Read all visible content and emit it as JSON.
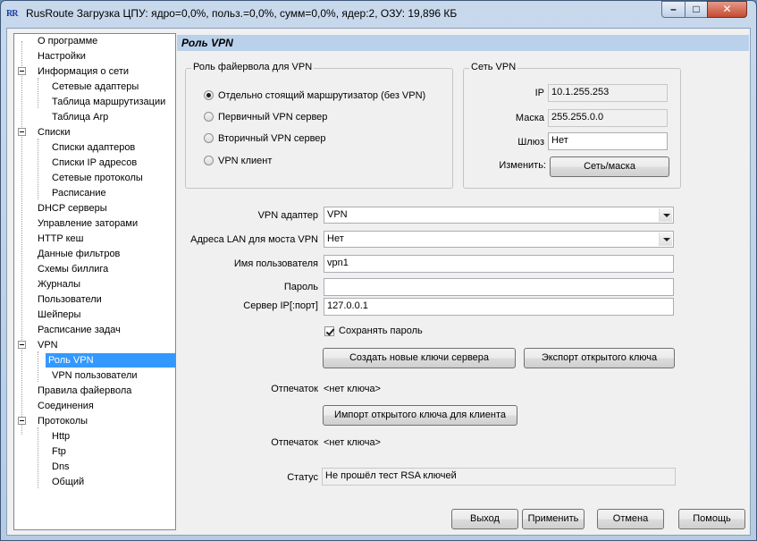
{
  "window": {
    "app_icon": "RR",
    "title": "RusRoute   Загрузка ЦПУ: ядро=0,0%, польз.=0,0%, сумм=0,0%, ядер:2,  ОЗУ: 19,896 КБ",
    "minimize_icon": "minimize-icon",
    "maximize_icon": "maximize-icon",
    "close_icon": "close-icon",
    "close_glyph": "✕"
  },
  "tree": {
    "items": [
      {
        "label": "О программе"
      },
      {
        "label": "Настройки"
      },
      {
        "label": "Информация о сети"
      },
      {
        "label": "Сетевые адаптеры"
      },
      {
        "label": "Таблица маршрутизации"
      },
      {
        "label": "Таблица Arp"
      },
      {
        "label": "Списки"
      },
      {
        "label": "Списки адаптеров"
      },
      {
        "label": "Списки IP адресов"
      },
      {
        "label": "Сетевые протоколы"
      },
      {
        "label": "Расписание"
      },
      {
        "label": "DHCP серверы"
      },
      {
        "label": "Управление заторами"
      },
      {
        "label": "HTTP кеш"
      },
      {
        "label": "Данные фильтров"
      },
      {
        "label": "Схемы биллига"
      },
      {
        "label": "Журналы"
      },
      {
        "label": "Пользователи"
      },
      {
        "label": "Шейперы"
      },
      {
        "label": "Расписание задач"
      },
      {
        "label": "VPN"
      },
      {
        "label": "Роль VPN"
      },
      {
        "label": "VPN пользователи"
      },
      {
        "label": "Правила файервола"
      },
      {
        "label": "Соединения"
      },
      {
        "label": "Протоколы"
      },
      {
        "label": "Http"
      },
      {
        "label": "Ftp"
      },
      {
        "label": "Dns"
      },
      {
        "label": "Общий"
      }
    ]
  },
  "panel": {
    "title": "Роль VPN",
    "firewall_role": {
      "title": "Роль файервола для VPN",
      "options": [
        {
          "label": "Отдельно стоящий маршрутизатор (без VPN)",
          "checked": true
        },
        {
          "label": "Первичный VPN сервер",
          "checked": false
        },
        {
          "label": "Вторичный VPN сервер",
          "checked": false
        },
        {
          "label": "VPN клиент",
          "checked": false
        }
      ]
    },
    "vpn_network": {
      "title": "Сеть VPN",
      "ip_label": "IP",
      "ip_value": "10.1.255.253",
      "mask_label": "Маска",
      "mask_value": "255.255.0.0",
      "gateway_label": "Шлюз",
      "gateway_value": "Нет",
      "change_label": "Изменить:",
      "change_button": "Сеть/маска"
    },
    "vpn_adapter_label": "VPN адаптер",
    "vpn_adapter_value": "VPN",
    "lan_bridge_label": "Адреса LAN для моста VPN",
    "lan_bridge_value": "Нет",
    "username_label": "Имя пользователя",
    "username_value": "vpn1",
    "password_label": "Пароль",
    "password_value": "",
    "server_label": "Сервер IP[:порт]",
    "server_value": "127.0.0.1",
    "save_password_label": "Сохранять пароль",
    "save_password_checked": true,
    "create_keys_button": "Создать новые ключи сервера",
    "export_key_button": "Экспорт открытого ключа",
    "fingerprint1_label": "Отпечаток",
    "fingerprint1_value": "<нет ключа>",
    "import_key_button": "Импорт открытого ключа для клиента",
    "fingerprint2_label": "Отпечаток",
    "fingerprint2_value": "<нет ключа>",
    "status_label": "Статус",
    "status_value": "Не прошёл тест RSA ключей"
  },
  "footer": {
    "exit_button": "Выход",
    "apply_button": "Применить",
    "cancel_button": "Отмена",
    "help_button": "Помощь"
  }
}
